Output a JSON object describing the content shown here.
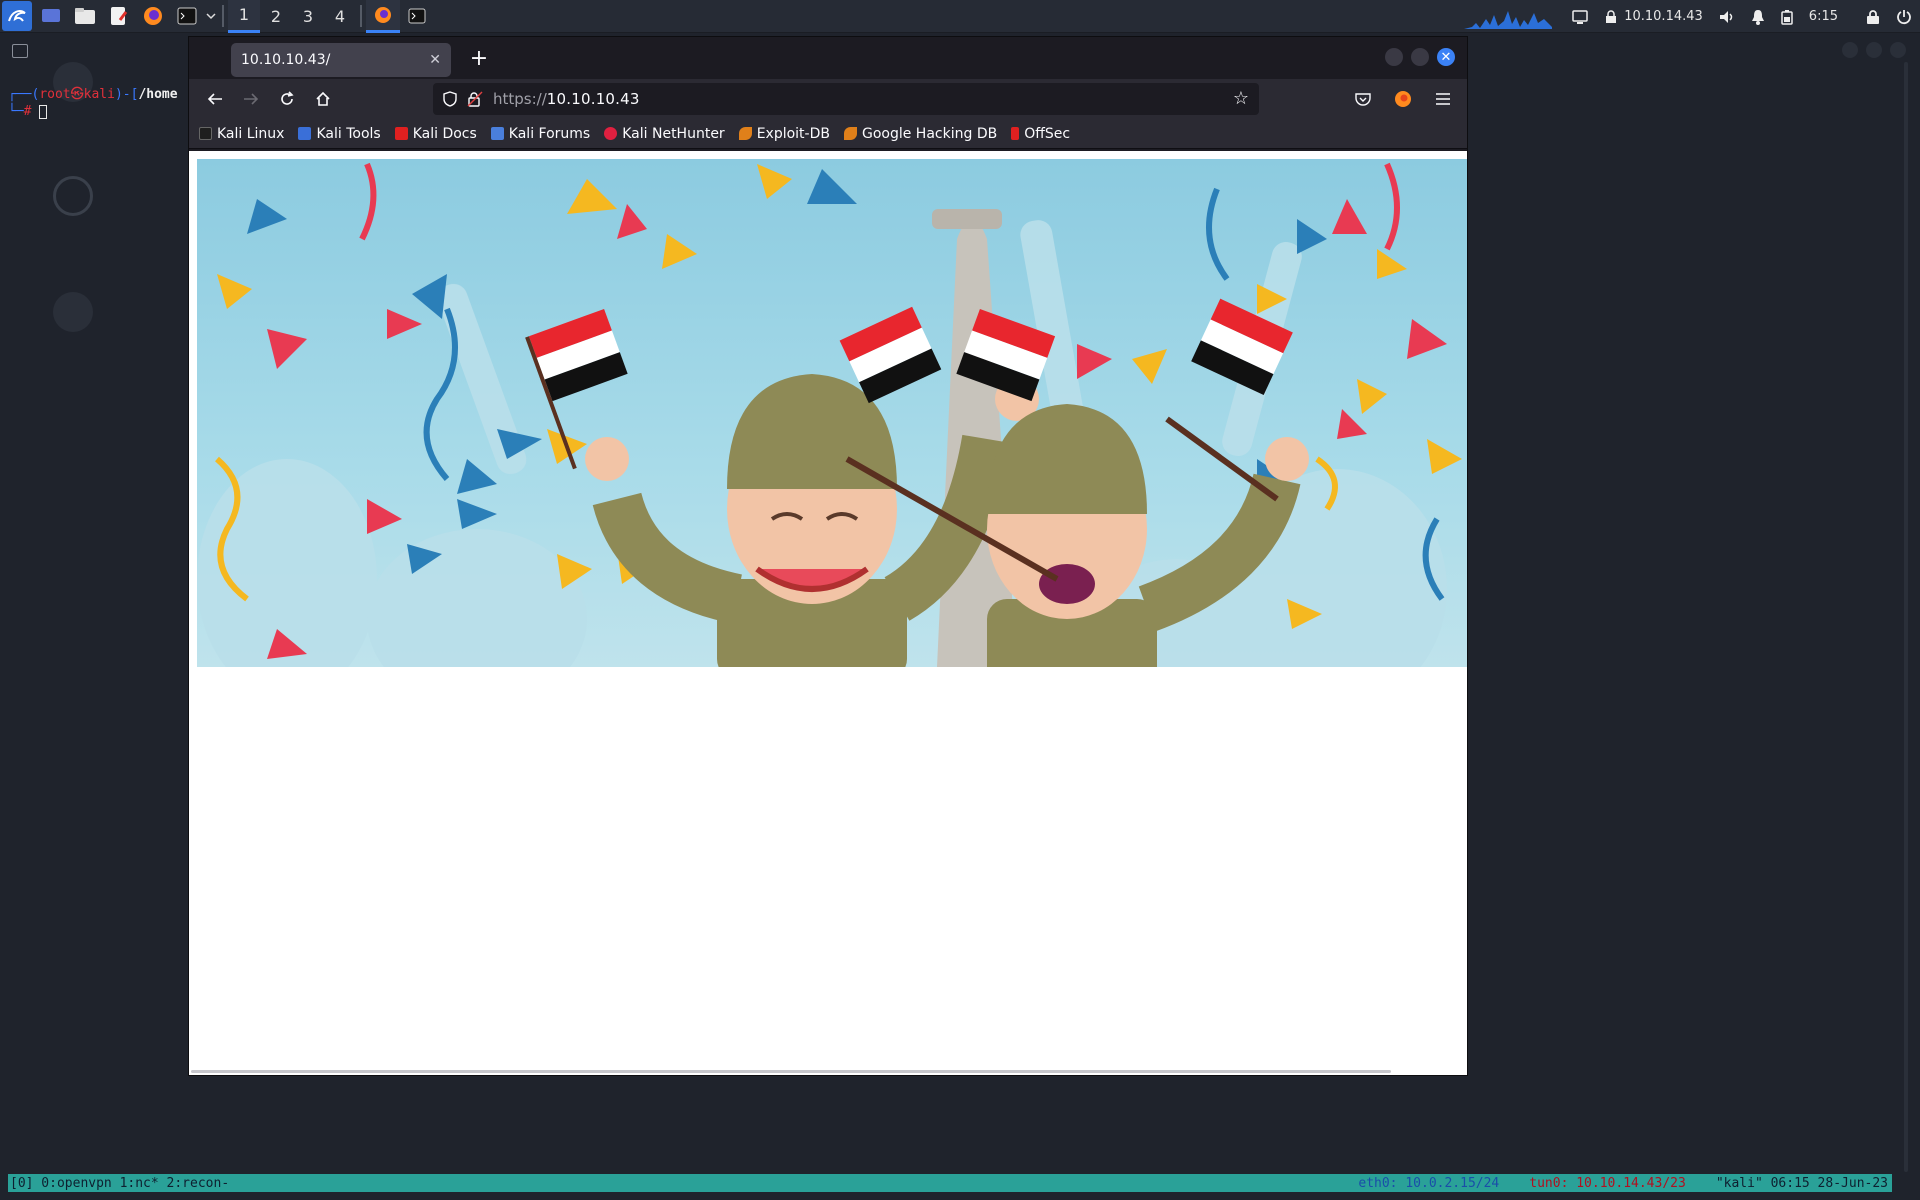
{
  "panel": {
    "workspaces": [
      "1",
      "2",
      "3",
      "4"
    ],
    "active_workspace": "1",
    "tray": {
      "ip": "10.10.14.43",
      "time": "6:15"
    }
  },
  "desktop": {
    "prompt_user": "root",
    "prompt_at": "㉿",
    "prompt_host": "kali",
    "prompt_path": "/home",
    "prompt_symbol": "#"
  },
  "browser": {
    "tab_title": "10.10.10.43/",
    "url_scheme": "https://",
    "url_host": "10.10.10.43",
    "bookmarks": [
      {
        "label": "Kali Linux",
        "color": "#1f1f1f"
      },
      {
        "label": "Kali Tools",
        "color": "#3a6fd8"
      },
      {
        "label": "Kali Docs",
        "color": "#e02020"
      },
      {
        "label": "Kali Forums",
        "color": "#4a7fdc"
      },
      {
        "label": "Kali NetHunter",
        "color": "#e02040"
      },
      {
        "label": "Exploit-DB",
        "color": "#e0801a"
      },
      {
        "label": "Google Hacking DB",
        "color": "#e0801a"
      },
      {
        "label": "OffSec",
        "color": "#e02020"
      }
    ]
  },
  "tmux": {
    "left": "[0] 0:openvpn  1:nc*  2:recon-",
    "eth_label": "eth0:",
    "eth_ip": "10.0.2.15/24",
    "tun_label": "tun0:",
    "tun_ip": "10.10.14.43/23",
    "host_time_date": "\"kali\" 06:15 28-Jun-23"
  },
  "colors": {
    "accent": "#3b82f6",
    "tmux_bar": "#2aa198",
    "sky": "#8ccbe0"
  }
}
